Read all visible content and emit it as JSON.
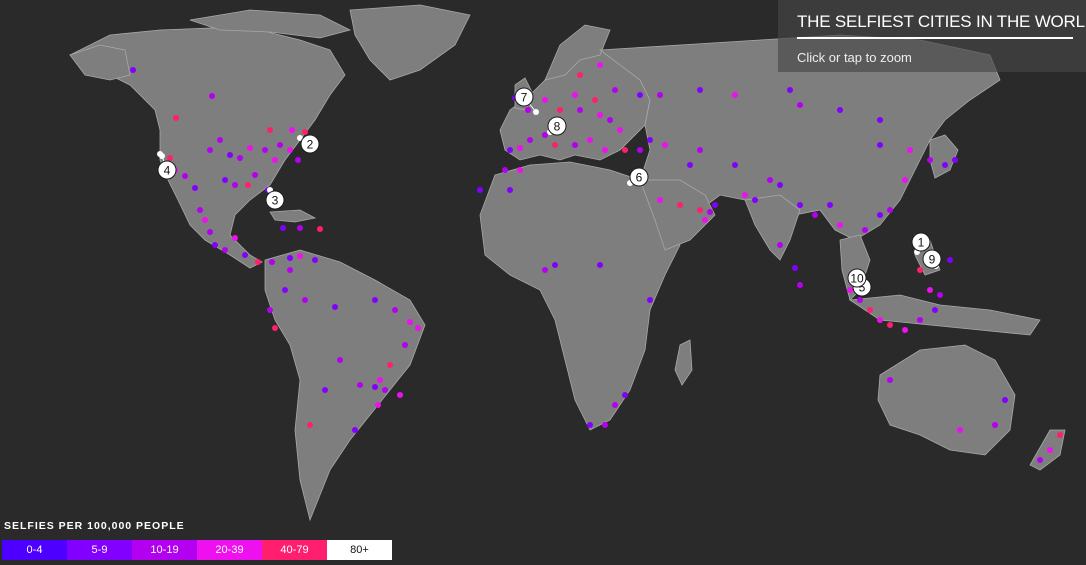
{
  "title": "THE SELFIEST CITIES IN THE WORLD",
  "zoom_hint": "Click or tap to zoom",
  "legend": {
    "title": "SELFIES PER 100,000 PEOPLE",
    "bins": [
      {
        "label": "0-4",
        "color": "#4d00ff",
        "text_color": "#ffffff"
      },
      {
        "label": "5-9",
        "color": "#8200ff",
        "text_color": "#ffffff"
      },
      {
        "label": "10-19",
        "color": "#b400f0",
        "text_color": "#ffffff"
      },
      {
        "label": "20-39",
        "color": "#ee10ee",
        "text_color": "#ffffff"
      },
      {
        "label": "40-79",
        "color": "#ff1f6e",
        "text_color": "#ffffff"
      },
      {
        "label": "80+",
        "color": "#ffffff",
        "text_color": "#111111"
      }
    ]
  },
  "rank_markers": [
    {
      "rank": "1"
    },
    {
      "rank": "2"
    },
    {
      "rank": "3"
    },
    {
      "rank": "4"
    },
    {
      "rank": "5"
    },
    {
      "rank": "6"
    },
    {
      "rank": "7"
    },
    {
      "rank": "8"
    },
    {
      "rank": "9"
    },
    {
      "rank": "10"
    }
  ],
  "colors": {
    "background": "#2a2a2a",
    "land": "#7e7e7e",
    "borders": "#a8a8a8"
  }
}
